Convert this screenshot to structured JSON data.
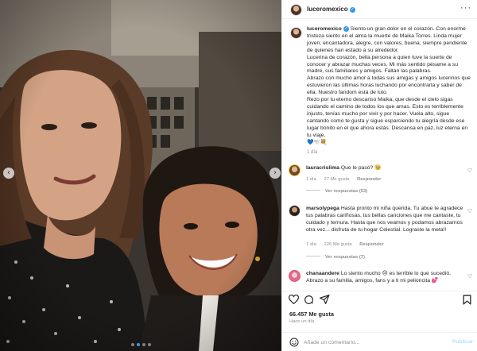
{
  "post": {
    "username": "luceromexico",
    "more_icon": "more-horizontal-icon",
    "verified_icon": "verified-badge-icon"
  },
  "photo": {
    "prev_icon": "chevron-left-icon",
    "next_icon": "chevron-right-icon",
    "dots_total": 4,
    "dots_active_index": 1
  },
  "caption": {
    "username": "luceromexico",
    "p1": " Siento un gran dolor en el corazón. Con enorme tristeza siento en el alma la muerte de Maika Torres. Linda mujer joven, encantadora, alegre, con valores, buena, siempre pendiente de quienes han estado a su alrededor.",
    "p2": "Lucerina de corazón, bella persona a quien tuve la suerte de conocer y abrazar muchas veces. Mi más sentido pésame a su madre, sus familiares y amigos. Faltan las palabras.",
    "p3": "Abrazo con mucho amor a todas sus amigas y amigos lucerinos que estuvieron las últimas horas luchando por encontrarla y saber de ella. Nuestro fandom está de luto.",
    "p4": "Rezo por tu eterno descanso Maika, que desde el cielo sigas cuidando el camino de todos los que amas. Esto es terriblemente injusto, tenías mucho por vivir y por hacer. Vuela alto, sigue cantando como te gusta y sigue esparciendo tu alegría desde ese lugar bonito en el que ahora estás. Descansa en paz, luz eterna en tu viaje.",
    "emojis": "💙🕊️💐",
    "time": "1 día"
  },
  "comments": [
    {
      "username": "lauracrislima",
      "text": "Que le pasó? 🥹",
      "time": "1 día",
      "likes": "27 Me gusta",
      "reply": "Responder",
      "replies": "Ver respuestas (53)"
    },
    {
      "username": "marsolypega",
      "text": "Hasta pronto mi niña querida. Tu abue te agradece tus palabras cariñosas, tus bellas canciones que me cantaste, tu cuidado y ternura. Hasta que nos veamos y podamos abrazarnos otra vez... disfruta de tu hogar Celestial. Lograste la meta!!",
      "time": "1 día",
      "likes": "226 Me gusta",
      "reply": "Responder",
      "replies": "Ver respuestas (7)"
    },
    {
      "username": "chanaandere",
      "text": "Lo siento mucho 😢 es terrible lo que sucedió. Abrazo a su familia, amigos, fans y a ti mi pelioncita 💕",
      "time": "",
      "likes": "",
      "reply": "",
      "replies": ""
    }
  ],
  "actions": {
    "like_icon": "heart-icon",
    "comment_icon": "comment-icon",
    "share_icon": "send-icon",
    "save_icon": "bookmark-icon"
  },
  "stats": {
    "likes": "66.457 Me gusta",
    "ago": "Hace un día"
  },
  "add_comment": {
    "placeholder": "Añade un comentario...",
    "publish_label": "Publicar",
    "emoji_icon": "emoji-smile-icon"
  },
  "colors": {
    "accent": "#3897f0",
    "publish_disabled": "#b2dffc",
    "muted": "#8e8e8e"
  }
}
